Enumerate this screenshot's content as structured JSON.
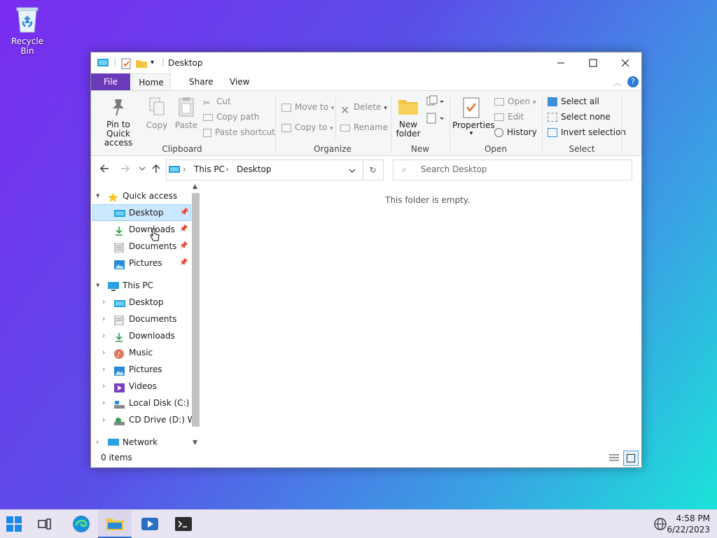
{
  "desktop": {
    "recycle_bin_label": "Recycle Bin"
  },
  "window": {
    "title": "Desktop",
    "controls": {
      "minimize": "—",
      "maximize": "☐",
      "close": "✕"
    }
  },
  "ribbon": {
    "tabs": [
      "File",
      "Home",
      "Share",
      "View"
    ],
    "clipboard": {
      "label": "Clipboard",
      "pin": "Pin to Quick access",
      "pin_l1": "Pin to Quick",
      "pin_l2": "access",
      "copy": "Copy",
      "paste": "Paste",
      "cut": "Cut",
      "copy_path": "Copy path",
      "paste_shortcut": "Paste shortcut"
    },
    "organize": {
      "label": "Organize",
      "move_to": "Move to",
      "copy_to": "Copy to",
      "delete": "Delete",
      "rename": "Rename"
    },
    "new": {
      "label": "New",
      "new_folder_l1": "New",
      "new_folder_l2": "folder"
    },
    "open": {
      "label": "Open",
      "properties": "Properties",
      "open": "Open",
      "edit": "Edit",
      "history": "History"
    },
    "select": {
      "label": "Select",
      "select_all": "Select all",
      "select_none": "Select none",
      "invert": "Invert selection"
    }
  },
  "address": {
    "crumbs": [
      "This PC",
      "Desktop"
    ],
    "search_placeholder": "Search Desktop"
  },
  "tree": {
    "quick_access": "Quick access",
    "quick_items": [
      "Desktop",
      "Downloads",
      "Documents",
      "Pictures"
    ],
    "this_pc": "This PC",
    "pc_items": [
      "Desktop",
      "Documents",
      "Downloads",
      "Music",
      "Pictures",
      "Videos",
      "Local Disk (C:)",
      "CD Drive (D:) Wi"
    ],
    "network": "Network"
  },
  "content": {
    "empty_text": "This folder is empty."
  },
  "status": {
    "items": "0 items"
  },
  "taskbar": {
    "time": "4:58 PM",
    "date": "6/22/2023"
  }
}
